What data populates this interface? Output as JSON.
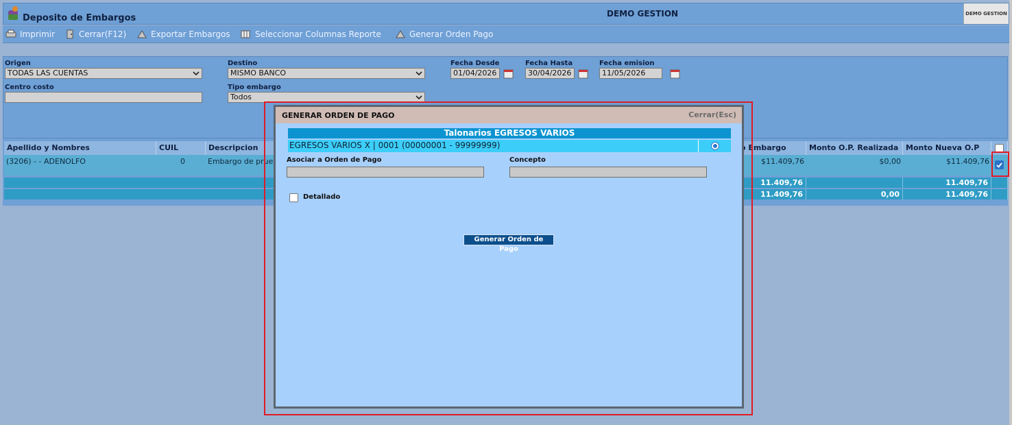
{
  "window": {
    "title": "Deposito de Embargos",
    "center_title": "DEMO GESTION",
    "logo_text": "DEMO GESTION"
  },
  "toolbar": {
    "items": [
      {
        "label": "Imprimir",
        "icon": "printer-icon"
      },
      {
        "label": "Cerrar(F12)",
        "icon": "close-door-icon"
      },
      {
        "label": "Exportar Embargos",
        "icon": "export-icon"
      },
      {
        "label": "Seleccionar Columnas Reporte",
        "icon": "columns-icon"
      },
      {
        "label": "Generar Orden Pago",
        "icon": "payment-order-icon"
      }
    ]
  },
  "filters": {
    "origen": {
      "label": "Origen",
      "value": "TODAS LAS CUENTAS"
    },
    "destino": {
      "label": "Destino",
      "value": "MISMO BANCO"
    },
    "fecha_desde": {
      "label": "Fecha Desde",
      "value": "01/04/2026"
    },
    "fecha_hasta": {
      "label": "Fecha Hasta",
      "value": "30/04/2026"
    },
    "fecha_emision": {
      "label": "Fecha emision",
      "value": "11/05/2026"
    },
    "centro_costo": {
      "label": "Centro costo",
      "value": ""
    },
    "tipo_embargo": {
      "label": "Tipo embargo",
      "value": "Todos"
    }
  },
  "table": {
    "headers": {
      "apellido": "Apellido y Nombres",
      "cuil": "CUIL",
      "descripcion": "Descripcion",
      "monto_embargo": "o Embargo",
      "monto_op_realizada": "Monto O.P. Realizada",
      "monto_nueva_op": "Monto Nueva O.P"
    },
    "rows": [
      {
        "apellido": "(3206) - - ADENOLFO",
        "cuil": "0",
        "descripcion": "Embargo de prue",
        "monto_embargo": "$11.409,76",
        "monto_op_realizada": "$0,00",
        "monto_nueva_op": "$11.409,76",
        "selected": true
      }
    ],
    "totals": [
      {
        "monto_embargo": "11.409,76",
        "monto_op_realizada": "",
        "monto_nueva_op": "11.409,76"
      },
      {
        "monto_embargo": "11.409,76",
        "monto_op_realizada": "0,00",
        "monto_nueva_op": "11.409,76"
      }
    ]
  },
  "modal": {
    "title": "GENERAR ORDEN DE PAGO",
    "close_label": "Cerrar(Esc)",
    "talonarios_header": "Talonarios EGRESOS VARIOS",
    "talonario_option": "EGRESOS VARIOS X | 0001 (00000001 - 99999999)",
    "asociar_label": "Asociar a Orden de Pago",
    "asociar_value": "",
    "concepto_label": "Concepto",
    "concepto_value": "",
    "detallado_label": "Detallado",
    "submit_label": "Generar Orden de Pago"
  },
  "colors": {
    "highlight": "#e01b24",
    "header_blue": "#6fa0d6",
    "modal_body": "#a7d0fc"
  }
}
